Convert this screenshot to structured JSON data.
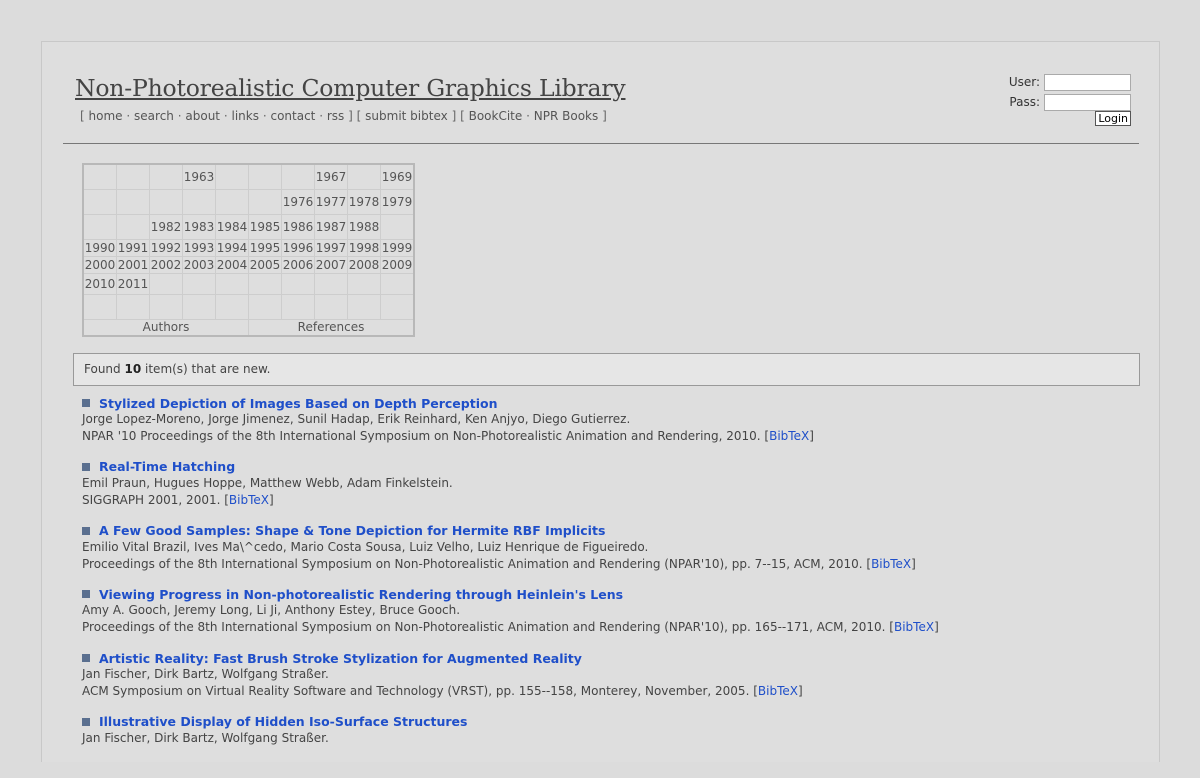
{
  "site": {
    "title": "Non-Photorealistic Computer Graphics Library"
  },
  "nav": {
    "open": "[",
    "close": "]",
    "dot": "·",
    "items": [
      "home",
      "search",
      "about",
      "links",
      "contact",
      "rss",
      "submit bibtex",
      "BookCite",
      "NPR Books"
    ]
  },
  "login": {
    "user_label": "User:",
    "pass_label": "Pass:",
    "button_label": "Login",
    "user_value": "",
    "pass_value": ""
  },
  "year_grid": {
    "rows": [
      [
        "",
        "",
        "",
        "1963",
        "",
        "",
        "",
        "1967",
        "",
        "1969"
      ],
      [
        "",
        "",
        "",
        "",
        "",
        "",
        "1976",
        "1977",
        "1978",
        "1979"
      ],
      [
        "",
        "",
        "1982",
        "1983",
        "1984",
        "1985",
        "1986",
        "1987",
        "1988",
        ""
      ],
      [
        "1990",
        "1991",
        "1992",
        "1993",
        "1994",
        "1995",
        "1996",
        "1997",
        "1998",
        "1999"
      ],
      [
        "2000",
        "2001",
        "2002",
        "2003",
        "2004",
        "2005",
        "2006",
        "2007",
        "2008",
        "2009"
      ],
      [
        "2010",
        "2011",
        "",
        "",
        "",
        "",
        "",
        "",
        "",
        ""
      ],
      [
        "",
        "",
        "",
        "",
        "",
        "",
        "",
        "",
        "",
        ""
      ]
    ],
    "authors_label": "Authors",
    "references_label": "References"
  },
  "found": {
    "prefix": "Found",
    "count": "10",
    "suffix": "item(s) that are new."
  },
  "results": [
    {
      "title": "Stylized Depiction of Images Based on Depth Perception",
      "authors": "Jorge Lopez-Moreno, Jorge Jimenez, Sunil Hadap, Erik Reinhard, Ken Anjyo, Diego Gutierrez.",
      "venue": "NPAR '10 Proceedings of the 8th International Symposium on Non-Photorealistic Animation and Rendering, 2010. [",
      "bibtex": "BibTeX",
      "close": "]"
    },
    {
      "title": "Real-Time Hatching",
      "authors": "Emil Praun, Hugues Hoppe, Matthew Webb, Adam Finkelstein.",
      "venue": "SIGGRAPH 2001, 2001. [",
      "bibtex": "BibTeX",
      "close": "]"
    },
    {
      "title": "A Few Good Samples: Shape & Tone Depiction for Hermite RBF Implicits",
      "authors": "Emilio Vital Brazil, Ives Ma\\^cedo, Mario Costa Sousa, Luiz Velho, Luiz Henrique de Figueiredo.",
      "venue": "Proceedings of the 8th International Symposium on Non-Photorealistic Animation and Rendering (NPAR'10), pp. 7--15, ACM, 2010. [",
      "bibtex": "BibTeX",
      "close": "]"
    },
    {
      "title": "Viewing Progress in Non-photorealistic Rendering through Heinlein's Lens",
      "authors": "Amy A. Gooch, Jeremy Long, Li Ji, Anthony Estey, Bruce Gooch.",
      "venue": "Proceedings of the 8th International Symposium on Non-Photorealistic Animation and Rendering (NPAR'10), pp. 165--171, ACM, 2010. [",
      "bibtex": "BibTeX",
      "close": "]"
    },
    {
      "title": "Artistic Reality: Fast Brush Stroke Stylization for Augmented Reality",
      "authors": "Jan Fischer, Dirk Bartz, Wolfgang Straßer.",
      "venue": "ACM Symposium on Virtual Reality Software and Technology (VRST), pp. 155--158, Monterey, November, 2005. [",
      "bibtex": "BibTeX",
      "close": "]"
    },
    {
      "title": "Illustrative Display of Hidden Iso-Surface Structures",
      "authors": "Jan Fischer, Dirk Bartz, Wolfgang Straßer.",
      "venue": "",
      "bibtex": "",
      "close": ""
    }
  ]
}
